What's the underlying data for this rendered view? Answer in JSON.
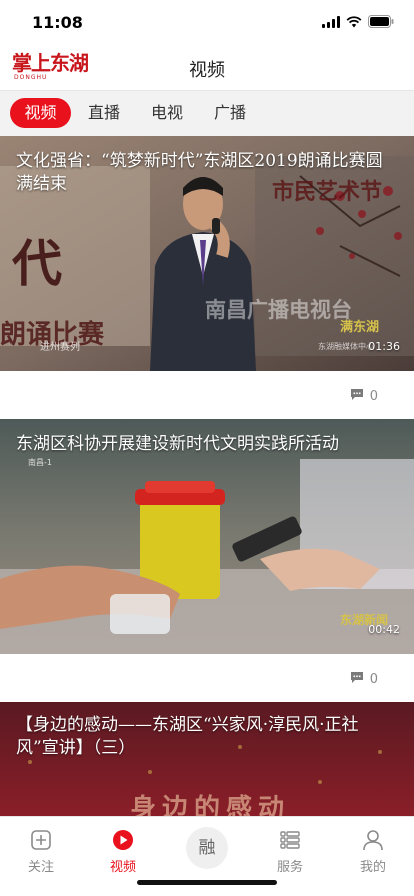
{
  "status": {
    "time": "11:08"
  },
  "header": {
    "logo_text": "掌上东湖",
    "logo_sub": "DONGHU",
    "title": "视频"
  },
  "tabs": [
    {
      "label": "视频",
      "active": true
    },
    {
      "label": "直播",
      "active": false
    },
    {
      "label": "电视",
      "active": false
    },
    {
      "label": "广播",
      "active": false
    }
  ],
  "videos": [
    {
      "title": "文化强省：“筑梦新时代”东湖区2019朗诵比赛圆满结束",
      "duration": "01:36",
      "comments": "0",
      "overlay": {
        "banner_right": "市民艺术节",
        "banner_left": "代",
        "banner_bottom": "朗诵比赛",
        "watermark": "南昌广播电视台",
        "logo": "满东湖",
        "logo_sub": "东湖融媒体中心",
        "series": "进州赛列"
      }
    },
    {
      "title": "东湖区科协开展建设新时代文明实践所活动",
      "duration": "00:42",
      "comments": "0",
      "overlay": {
        "corner": "南昌-1",
        "logo": "东湖新闻"
      }
    },
    {
      "title": "【身边的感动——东湖区“兴家风·淳民风·正社风”宣讲】（三）",
      "overlay": {
        "big": "身边的感动"
      }
    }
  ],
  "bottom_nav": [
    {
      "label": "关注",
      "icon": "plus-square-icon",
      "active": false
    },
    {
      "label": "视频",
      "icon": "play-circle-icon",
      "active": true
    },
    {
      "label": "融",
      "icon": "rong-center-icon",
      "active": false
    },
    {
      "label": "服务",
      "icon": "list-icon",
      "active": false
    },
    {
      "label": "我的",
      "icon": "user-icon",
      "active": false
    }
  ],
  "colors": {
    "accent": "#e8111c",
    "brand": "#c8161d",
    "inactive": "#8a8a8a"
  }
}
